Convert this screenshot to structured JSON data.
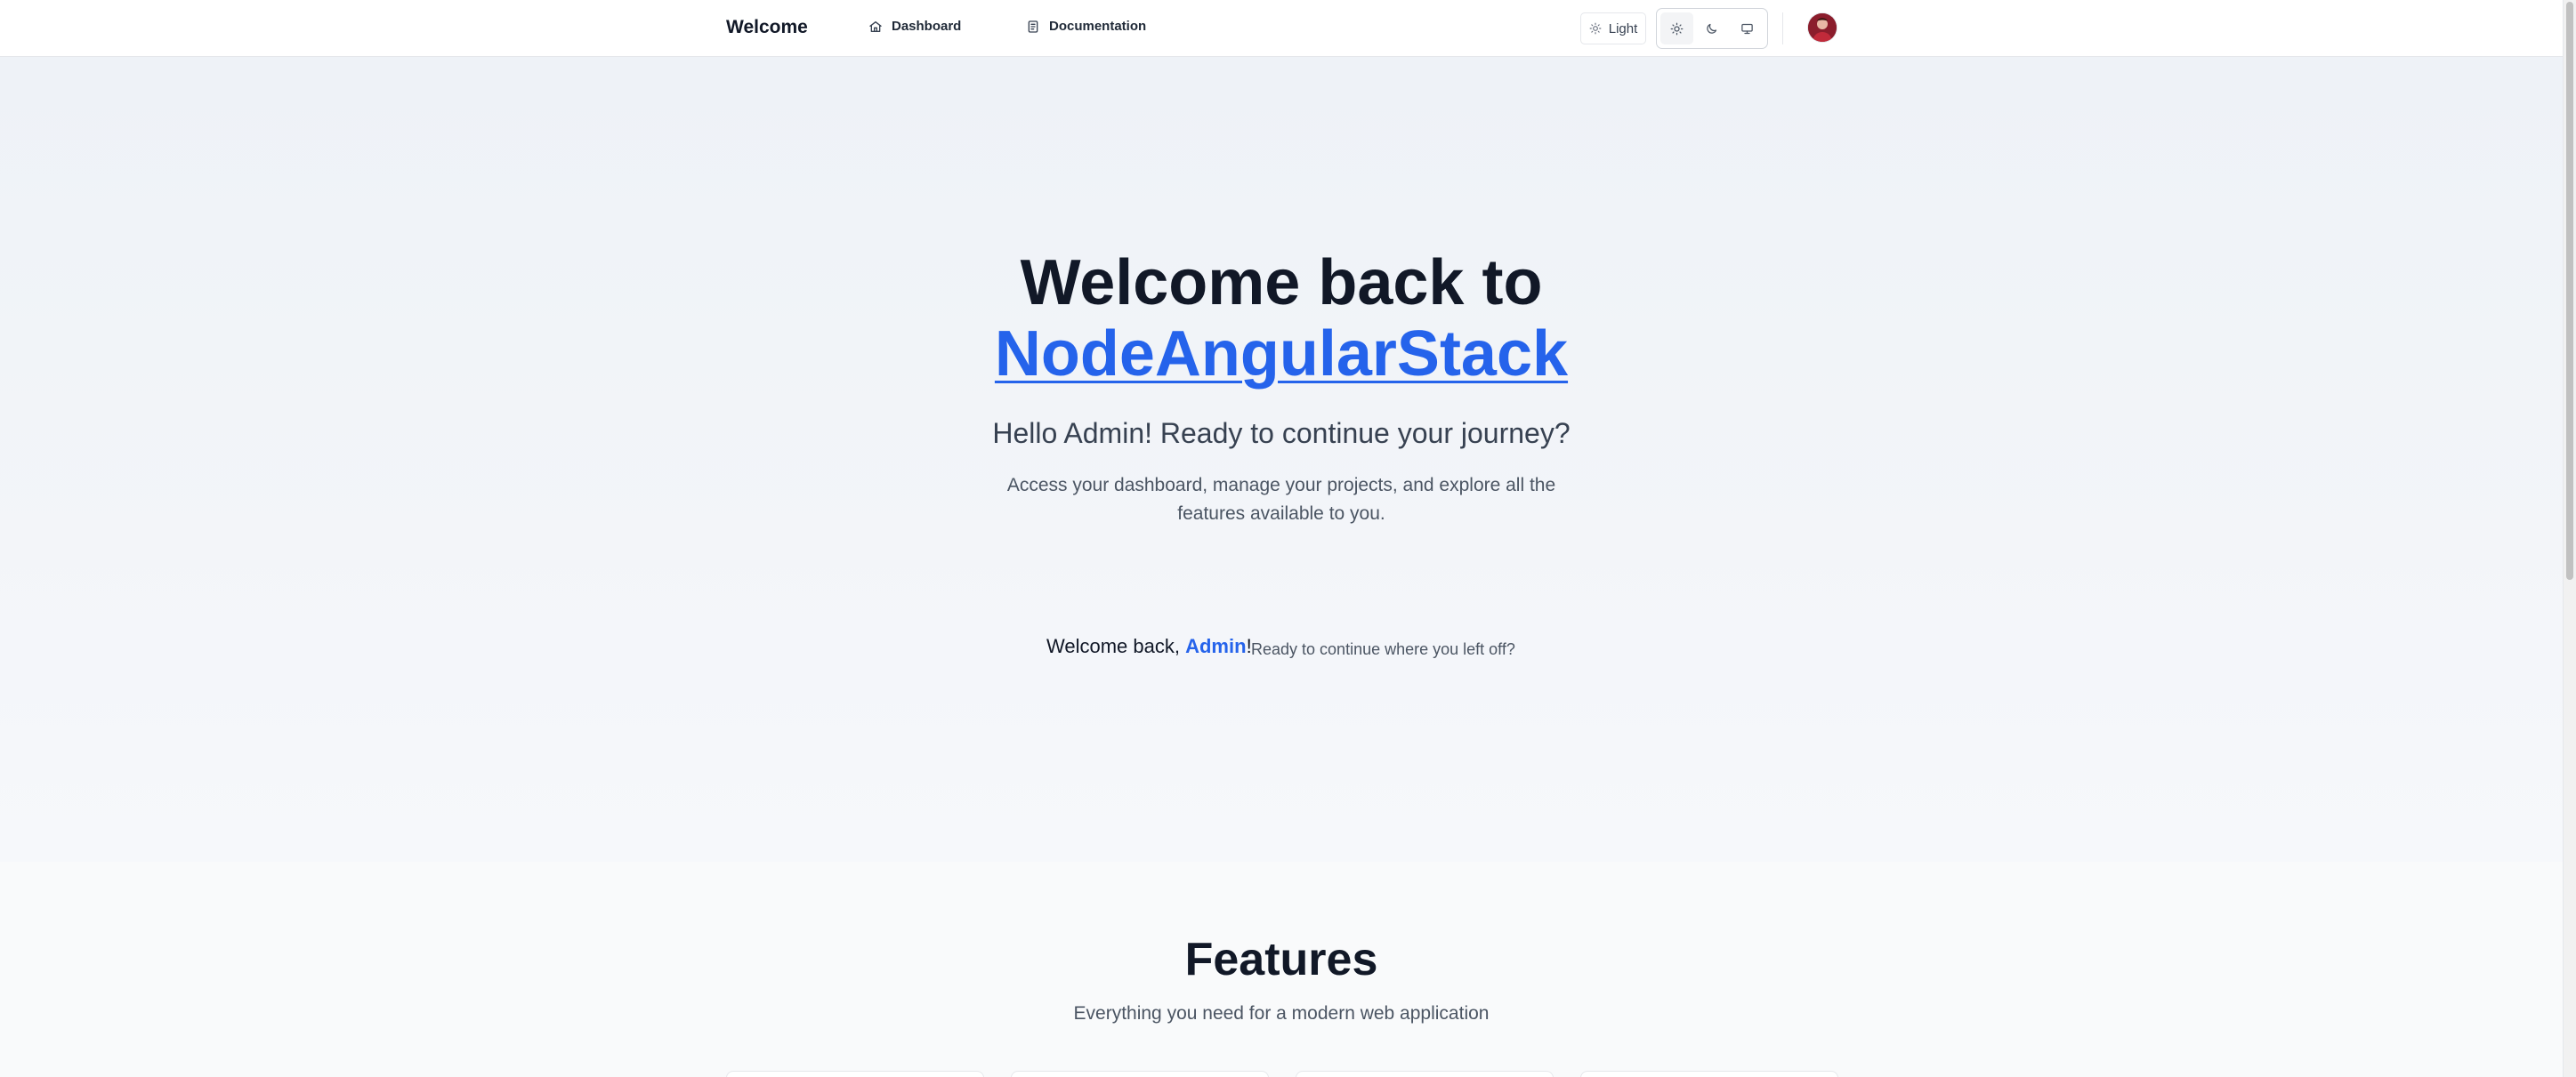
{
  "header": {
    "brand": "Welcome",
    "nav": [
      {
        "label": "Dashboard",
        "icon": "home-icon"
      },
      {
        "label": "Documentation",
        "icon": "document-icon"
      }
    ],
    "theme_label": "Light",
    "theme_options": [
      {
        "name": "light",
        "icon": "sun-icon",
        "active": true
      },
      {
        "name": "dark",
        "icon": "moon-icon",
        "active": false
      },
      {
        "name": "system",
        "icon": "monitor-icon",
        "active": false
      }
    ],
    "avatar": "user-avatar"
  },
  "hero": {
    "title_line1": "Welcome back to",
    "title_line2": "NodeAngularStack",
    "subtitle": "Hello Admin! Ready to continue your journey?",
    "description": "Access your dashboard, manage your projects, and explore all the features available to you.",
    "welcome_prefix": "Welcome back, ",
    "welcome_name": "Admin",
    "welcome_suffix": "!",
    "welcome_hint": "Ready to continue where you left off?"
  },
  "features": {
    "title": "Features",
    "subtitle": "Everything you need for a modern web application"
  },
  "colors": {
    "accent": "#2563eb",
    "text": "#111827",
    "muted": "#4b5563",
    "avatar_bg": "#8b1d2c"
  }
}
